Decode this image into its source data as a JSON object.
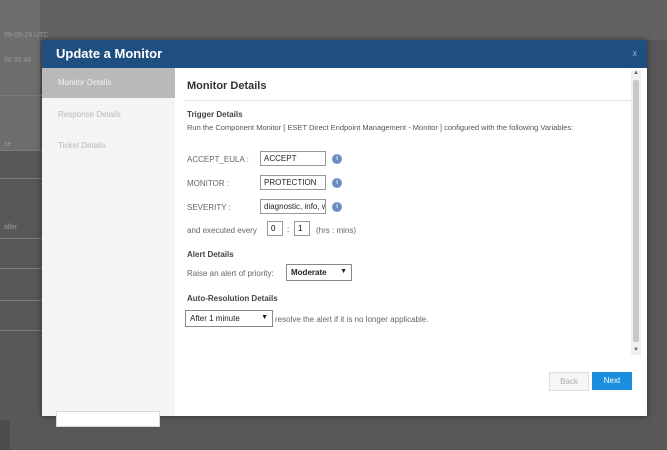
{
  "background": {
    "line1": "09-05-29 UTC",
    "line2": "08 30 46",
    "line3": "se",
    "line4": "aller"
  },
  "modal": {
    "title": "Update a Monitor",
    "close": "x",
    "sidebar": [
      {
        "label": "Monitor Details",
        "active": true
      },
      {
        "label": "Response Details",
        "active": false
      },
      {
        "label": "Ticket Details",
        "active": false
      }
    ],
    "content": {
      "title": "Monitor Details",
      "trigger_heading": "Trigger Details",
      "trigger_desc": "Run the Component Monitor [ ESET Direct Endpoint Management - Monitor ] configured with the following Variables:",
      "vars": [
        {
          "label": "ACCEPT_EULA :",
          "value": "ACCEPT"
        },
        {
          "label": "MONITOR :",
          "value": "PROTECTION"
        },
        {
          "label": "SEVERITY :",
          "value": "diagnostic, info, w"
        }
      ],
      "executed_prefix": "and executed every",
      "executed_hrs": "0",
      "executed_sep": ":",
      "executed_mins": "1",
      "executed_suffix": "(hrs : mins)",
      "alert_heading": "Alert Details",
      "alert_label": "Raise an alert of priority:",
      "alert_priority": "Moderate",
      "auto_heading": "Auto-Resolution Details",
      "auto_select": "After 1 minute",
      "auto_suffix": "resolve the alert if it is no longer applicable."
    },
    "buttons": {
      "back": "Back",
      "next": "Next"
    }
  }
}
